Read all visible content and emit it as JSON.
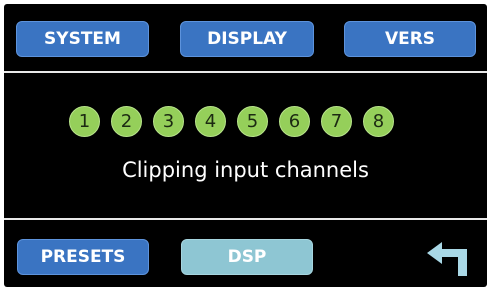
{
  "top_bar": {
    "system_label": "SYSTEM",
    "display_label": "DISPLAY",
    "vers_label": "VERS"
  },
  "main": {
    "channels": [
      "1",
      "2",
      "3",
      "4",
      "5",
      "6",
      "7",
      "8"
    ],
    "caption": "Clipping input channels",
    "channel_color": "#95cf5a"
  },
  "bottom_bar": {
    "presets_label": "PRESETS",
    "dsp_label": "DSP",
    "back_icon": "return-arrow-icon"
  },
  "colors": {
    "background": "#000000",
    "button": "#3a74c2",
    "button_active": "#8ec6d3",
    "divider": "#e8e8e8",
    "back_arrow": "#a9d8e6"
  }
}
